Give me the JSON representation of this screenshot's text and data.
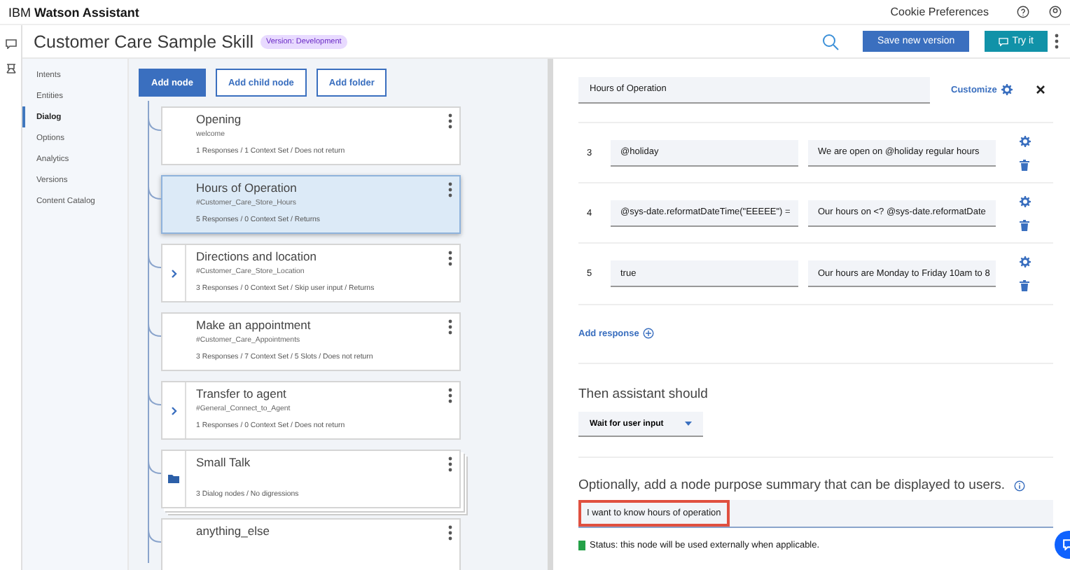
{
  "top_bar": {
    "brand_light": "IBM",
    "brand_bold": "Watson Assistant",
    "link": "Cookie Preferences"
  },
  "header": {
    "title": "Customer Care Sample Skill",
    "badge": "Version: Development",
    "save_button": "Save new version",
    "try_button": "Try it"
  },
  "sidebar": {
    "items": [
      {
        "label": "Intents",
        "selected": false
      },
      {
        "label": "Entities",
        "selected": false
      },
      {
        "label": "Dialog",
        "selected": true
      },
      {
        "label": "Options",
        "selected": false
      },
      {
        "label": "Analytics",
        "selected": false
      },
      {
        "label": "Versions",
        "selected": false
      },
      {
        "label": "Content Catalog",
        "selected": false
      }
    ]
  },
  "toolbar": {
    "buttons": [
      {
        "label": "Add node",
        "kind": "primary"
      },
      {
        "label": "Add child node",
        "kind": "outline"
      },
      {
        "label": "Add folder",
        "kind": "outline"
      }
    ]
  },
  "nodes": [
    {
      "kind": "node",
      "title": "Opening",
      "condition": "welcome",
      "summary": "1 Responses / 1 Context Set / Does not return",
      "selected": false,
      "expandable": false
    },
    {
      "kind": "node",
      "title": "Hours of Operation",
      "condition": "#Customer_Care_Store_Hours",
      "summary": "5 Responses / 0 Context Set / Returns",
      "selected": true,
      "expandable": false
    },
    {
      "kind": "node",
      "title": "Directions and location",
      "condition": "#Customer_Care_Store_Location",
      "summary": "3 Responses / 0 Context Set / Skip user input / Returns",
      "selected": false,
      "expandable": true
    },
    {
      "kind": "node",
      "title": "Make an appointment",
      "condition": "#Customer_Care_Appointments",
      "summary": "3 Responses / 7 Context Set / 5 Slots / Does not return",
      "selected": false,
      "expandable": false
    },
    {
      "kind": "node",
      "title": "Transfer to agent",
      "condition": "#General_Connect_to_Agent",
      "summary": "1 Responses / 0 Context Set / Does not return",
      "selected": false,
      "expandable": true
    },
    {
      "kind": "folder",
      "title": "Small Talk",
      "summary": "3 Dialog nodes / No digressions",
      "selected": false,
      "expandable": false
    },
    {
      "kind": "node",
      "title": "anything_else",
      "selected": false,
      "expandable": false
    }
  ],
  "editor": {
    "node_name": "Hours of Operation",
    "customize": "Customize",
    "responses": [
      {
        "number": "3",
        "condition": "@holiday",
        "response": "We are open on @holiday regular hours"
      },
      {
        "number": "4",
        "condition": "@sys-date.reformatDateTime(\"EEEEE\") =",
        "response": "Our hours on <? @sys-date.reformatDate"
      },
      {
        "number": "5",
        "condition": "true",
        "response": "Our hours are Monday to Friday 10am to 8"
      }
    ],
    "add_response": "Add response",
    "then_label": "Then assistant should",
    "then_value": "Wait for user input",
    "summary_label": "Optionally, add a node purpose summary that can be displayed to users.",
    "summary_value": "I want to know hours of operation",
    "status": "Status: this node will be used externally when applicable."
  }
}
